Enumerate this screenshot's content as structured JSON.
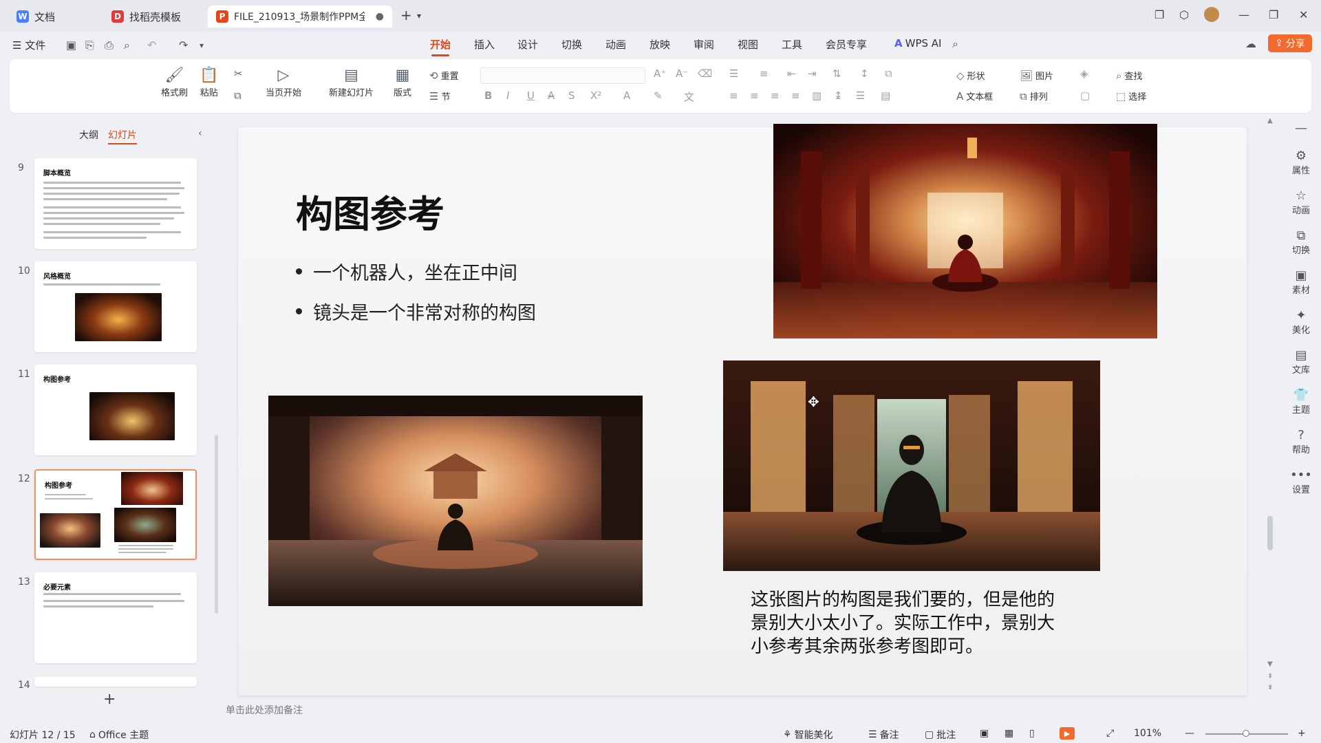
{
  "tabs": [
    {
      "label": "文档",
      "icon": "docs-icon",
      "color": "#4a7dff"
    },
    {
      "label": "找稻壳模板",
      "icon": "docer-icon",
      "color": "#e03a3a"
    },
    {
      "label": "FILE_210913_场景制作PPM全",
      "icon": "ppt-icon",
      "color": "#e0481b"
    }
  ],
  "menu": {
    "file": "文件",
    "items": [
      "开始",
      "插入",
      "设计",
      "切换",
      "动画",
      "放映",
      "审阅",
      "视图",
      "工具",
      "会员专享"
    ],
    "active": "开始",
    "wps_ai": "WPS AI",
    "share": "分享"
  },
  "ribbon": {
    "format_painter": "格式刷",
    "paste": "粘贴",
    "start_current": "当页开始",
    "new_slide": "新建幻灯片",
    "layout": "版式",
    "reset": "重置",
    "section": "节",
    "shape": "形状",
    "picture": "图片",
    "textbox": "文本框",
    "arrange": "排列",
    "find": "查找",
    "select": "选择"
  },
  "left_panel": {
    "outline_tab": "大纲",
    "slides_tab": "幻灯片",
    "thumbnails": [
      {
        "num": "9",
        "title": "脚本概览"
      },
      {
        "num": "10",
        "title": "风格概览"
      },
      {
        "num": "11",
        "title": "构图参考"
      },
      {
        "num": "12",
        "title": "构图参考"
      },
      {
        "num": "13",
        "title": "必要元素"
      },
      {
        "num": "14",
        "title": ""
      }
    ],
    "add_label": "+"
  },
  "slide": {
    "title": "构图参考",
    "bullets": [
      "一个机器人，坐在正中间",
      "镜头是一个非常对称的构图"
    ],
    "caption": "这张图片的构图是我们要的，但是他的景别大小太小了。实际工作中，景别大小参考其余两张参考图即可。"
  },
  "notes_placeholder": "单击此处添加备注",
  "right_bar": [
    "属性",
    "动画",
    "切换",
    "素材",
    "美化",
    "文库",
    "主题",
    "帮助",
    "设置"
  ],
  "status": {
    "slide_counter": "幻灯片 12 / 15",
    "theme": "Office 主题",
    "smart_beautify": "智能美化",
    "notes": "备注",
    "comments": "批注",
    "zoom": "101%"
  }
}
